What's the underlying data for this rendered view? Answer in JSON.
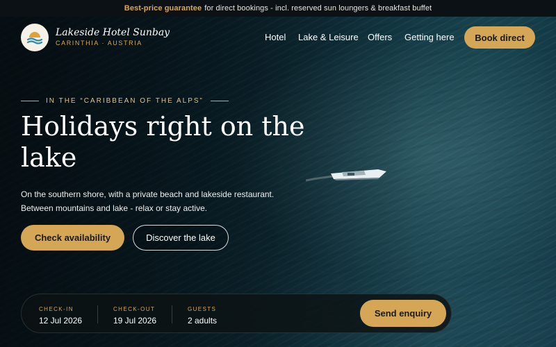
{
  "topbar": {
    "highlight": "Best-price guarantee",
    "text": "for direct bookings - incl. reserved sun loungers & breakfast buffet"
  },
  "brand": {
    "name": "Lakeside Hotel Sunbay",
    "location": "CARINTHIA · AUSTRIA",
    "logo_icon": "sun-over-waves-icon"
  },
  "nav": {
    "items": [
      "Hotel",
      "Lake & Leisure",
      "Offers",
      "Getting here"
    ],
    "cta": "Book direct"
  },
  "hero": {
    "eyebrow": "IN THE “CARIBBEAN OF THE ALPS”",
    "headline": "Holidays right on the lake",
    "lead_line1": "On the southern shore, with a private beach and lakeside restaurant.",
    "lead_line2": "Between mountains and lake - relax or stay active.",
    "primary_button": "Check availability",
    "secondary_button": "Discover the lake"
  },
  "booking": {
    "checkin_label": "CHECK-IN",
    "checkin_value": "12 Jul 2026",
    "checkout_label": "CHECK-OUT",
    "checkout_value": "19 Jul 2026",
    "guests_label": "GUESTS",
    "guests_value": "2 adults",
    "submit": "Send enquiry"
  },
  "colors": {
    "accent_gold": "#d4a655",
    "topbar_bg": "#0b1114",
    "lake_teal": "#123844"
  }
}
